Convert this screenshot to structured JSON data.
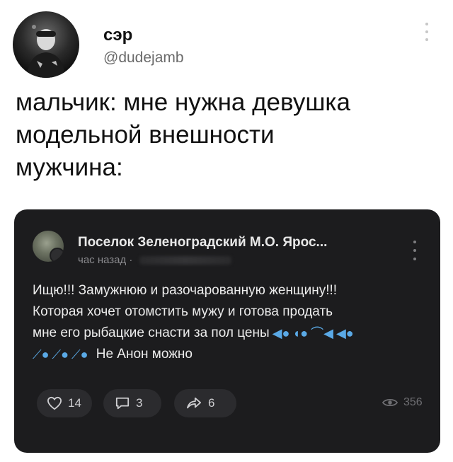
{
  "tweet": {
    "author_name": "сэр",
    "author_handle": "@dudejamb",
    "text_lines": [
      "мальчик: мне нужна девушка",
      "модельной внешности",
      "мужчина:"
    ]
  },
  "embedded_post": {
    "group_name": "Поселок Зеленоградский М.О. Ярос...",
    "time": "час назад ·",
    "text_lines": [
      "Ищю!!! Замужнюю и разочарованную женщину!!!",
      "Которая хочет отомстить мужу и готова продать",
      "мне его рыбацкие снасти за пол цены",
      "Не Анон можно"
    ],
    "emojis_line3": [
      "fish-icon",
      "whale-icon",
      "hook-fish-icon",
      "fish-icon"
    ],
    "emojis_line4": [
      "fishing-pole-icon",
      "fishing-pole-icon",
      "fishing-pole-icon"
    ],
    "likes": "14",
    "comments": "3",
    "shares": "6",
    "views": "356"
  },
  "colors": {
    "card_background": "#1c1c1e",
    "button_background": "#2b2b2e",
    "handle_gray": "#6a6a6a"
  }
}
